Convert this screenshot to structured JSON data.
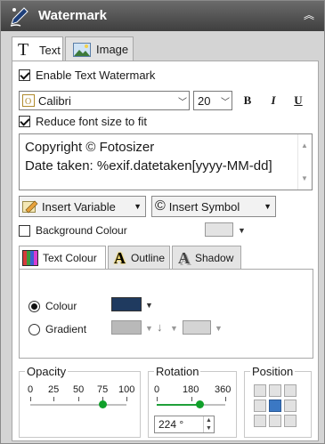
{
  "header": {
    "title": "Watermark",
    "icon": "watermark-pen-icon",
    "collapse_icon": "double-chevron-up-icon"
  },
  "tabs": [
    {
      "label": "Text",
      "icon": "text-T-icon",
      "active": true
    },
    {
      "label": "Image",
      "icon": "image-icon",
      "active": false
    }
  ],
  "enable_text_watermark": {
    "label": "Enable Text Watermark",
    "checked": true
  },
  "font": {
    "name": "Calibri",
    "size": "20",
    "bold_label": "B",
    "italic_label": "I",
    "underline_label": "U"
  },
  "reduce_font": {
    "label": "Reduce font size to fit",
    "checked": true
  },
  "watermark_text": {
    "line1": "Copyright © Fotosizer",
    "line2": "Date taken: %exif.datetaken[yyyy-MM-dd]"
  },
  "insert_variable": {
    "label": "Insert Variable"
  },
  "insert_symbol": {
    "label": "Insert Symbol"
  },
  "background_colour": {
    "label": "Background Colour",
    "checked": false,
    "color": "#e3e3e3"
  },
  "subtabs": [
    {
      "label": "Text Colour",
      "active": true
    },
    {
      "label": "Outline",
      "active": false
    },
    {
      "label": "Shadow",
      "active": false
    }
  ],
  "colour_option": {
    "label": "Colour",
    "selected": true,
    "color": "#1f3a5f"
  },
  "gradient_option": {
    "label": "Gradient",
    "selected": false,
    "color_start": "#b9b9b9",
    "color_end": "#d4d4d4"
  },
  "opacity": {
    "title": "Opacity",
    "ticks": [
      "0",
      "25",
      "50",
      "75",
      "100"
    ],
    "value": 75
  },
  "rotation": {
    "title": "Rotation",
    "ticks": [
      "0",
      "180",
      "360"
    ],
    "value": 224,
    "value_text": "224 °"
  },
  "position": {
    "title": "Position",
    "selected_index": 4
  }
}
